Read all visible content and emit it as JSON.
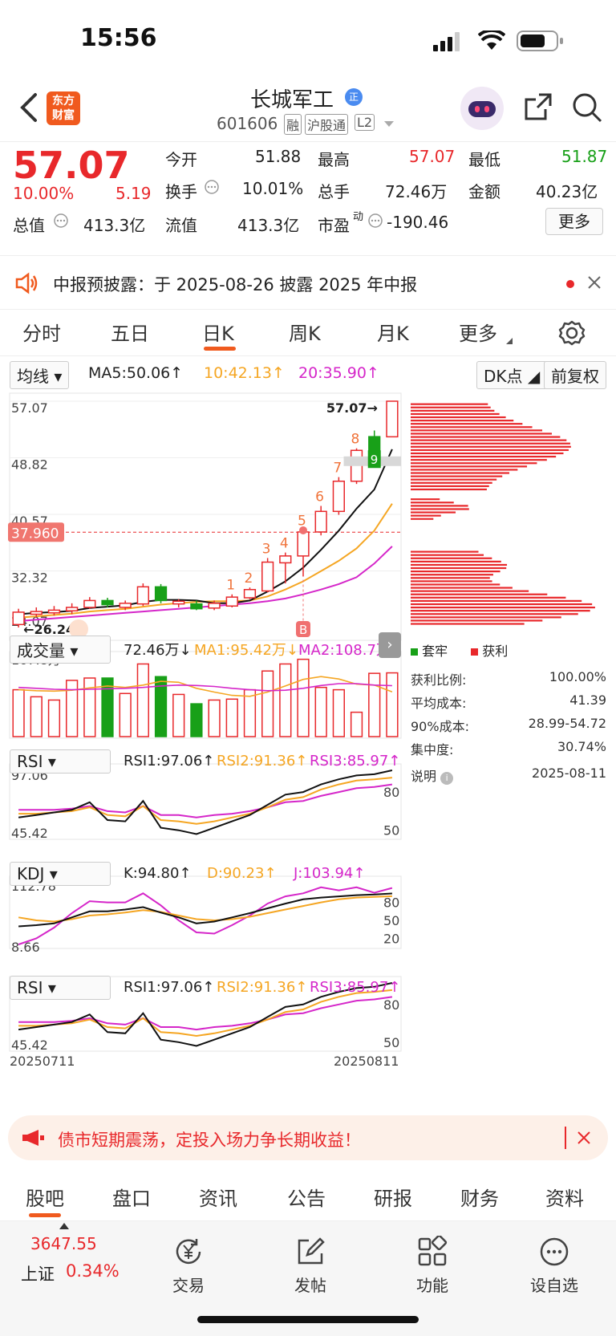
{
  "status": {
    "time": "15:56"
  },
  "header": {
    "logo_line1": "东方",
    "logo_line2": "财富",
    "title": "长城军工",
    "badge": "正",
    "code": "601606",
    "tags": [
      "融",
      "沪股通",
      "L2"
    ]
  },
  "quote": {
    "price": "57.07",
    "change_pct": "10.00%",
    "change": "5.19",
    "open_label": "今开",
    "open": "51.88",
    "high_label": "最高",
    "high": "57.07",
    "low_label": "最低",
    "low": "51.87",
    "turnover_label": "换手",
    "turnover": "10.01%",
    "volume_label": "总手",
    "volume": "72.46万",
    "amount_label": "金额",
    "amount": "40.23亿",
    "mktcap_label": "总值",
    "mktcap": "413.3亿",
    "float_label": "流值",
    "float": "413.3亿",
    "pe_label": "市盈",
    "pe_sup": "动",
    "pe": "-190.46",
    "more_button": "更多"
  },
  "notice": {
    "text": "中报预披露：于 2025-08-26 披露 2025 年中报"
  },
  "tabs": [
    "分时",
    "五日",
    "日K",
    "周K",
    "月K",
    "更多"
  ],
  "active_tab": "日K",
  "ma_bar": {
    "selector": "均线",
    "ma5": "MA5:50.06↑",
    "ma10": "10:42.13↑",
    "ma20": "20:35.90↑",
    "dk": "DK点",
    "adjust": "前复权"
  },
  "kline_axis": {
    "y_labels": [
      "57.07",
      "48.82",
      "40.57",
      "32.32",
      "24.07"
    ],
    "current_price_tag": "37.960",
    "high_marker": "57.07→",
    "low_marker": "←26.24",
    "signal_b": "B",
    "signal_9": "9",
    "counts": [
      "1",
      "2",
      "3",
      "4",
      "5",
      "6",
      "7",
      "8"
    ]
  },
  "volume_bar": {
    "selector": "成交量",
    "value": "72.46万↓",
    "ma1": "MA1:95.42万↓",
    "ma2": "MA2:108.7万",
    "max_label": "167.8万"
  },
  "rsi1": {
    "selector": "RSI",
    "r1": "RSI1:97.06↑",
    "r2": "RSI2:91.36↑",
    "r3": "RSI3:85.97↑",
    "top": "97.06",
    "bottom": "45.42",
    "lvl80": "80",
    "lvl50": "50"
  },
  "kdj": {
    "selector": "KDJ",
    "k": "K:94.80↑",
    "d": "D:90.23↑",
    "j": "J:103.94↑",
    "top": "112.78",
    "bottom": "8.66",
    "lvl80": "80",
    "lvl50": "50",
    "lvl20": "20"
  },
  "rsi2": {
    "selector": "RSI",
    "r1": "RSI1:97.06↑",
    "r2": "RSI2:91.36↑",
    "r3": "RSI3:85.97↑",
    "top": "97.06",
    "bottom": "45.42",
    "lvl80": "80",
    "lvl50": "50"
  },
  "dates": {
    "start": "20250711",
    "end": "20250811"
  },
  "chip": {
    "legend_trapped": "套牢",
    "legend_profit": "获利",
    "profit_ratio_label": "获利比例:",
    "profit_ratio": "100.00%",
    "avg_cost_label": "平均成本:",
    "avg_cost": "41.39",
    "cost90_label": "90%成本:",
    "cost90": "28.99-54.72",
    "concentration_label": "集中度:",
    "concentration": "30.74%",
    "note_label": "说明",
    "note_date": "2025-08-11"
  },
  "banner": {
    "text": "债市短期震荡，定投入场力争长期收益！"
  },
  "bottom_tabs": [
    "股吧",
    "盘口",
    "资讯",
    "公告",
    "研报",
    "财务",
    "资料"
  ],
  "bottom_bar": {
    "index_value": "3647.55",
    "index_name": "上证",
    "index_change": "0.34%",
    "items": [
      "交易",
      "发帖",
      "功能",
      "设自选"
    ]
  },
  "colors": {
    "up": "#e8282b",
    "down": "#18a018",
    "ma10": "#f5a623",
    "ma20": "#d526c9"
  },
  "chart_data": {
    "type": "candlestick",
    "dates_range": [
      "20250711",
      "20250811"
    ],
    "candles": [
      {
        "o": 24.5,
        "c": 26.3,
        "h": 26.8,
        "l": 24.07
      },
      {
        "o": 26.0,
        "c": 26.4,
        "h": 27.0,
        "l": 25.6
      },
      {
        "o": 26.2,
        "c": 26.6,
        "h": 27.2,
        "l": 25.8
      },
      {
        "o": 26.5,
        "c": 27.0,
        "h": 27.6,
        "l": 26.0
      },
      {
        "o": 27.0,
        "c": 28.0,
        "h": 28.5,
        "l": 26.8
      },
      {
        "o": 28.0,
        "c": 27.4,
        "h": 28.4,
        "l": 27.0
      },
      {
        "o": 27.0,
        "c": 27.6,
        "h": 28.0,
        "l": 26.6
      },
      {
        "o": 27.5,
        "c": 30.0,
        "h": 30.5,
        "l": 27.2
      },
      {
        "o": 30.0,
        "c": 28.0,
        "h": 30.4,
        "l": 27.6
      },
      {
        "o": 27.5,
        "c": 27.9,
        "h": 28.2,
        "l": 27.0
      },
      {
        "o": 27.5,
        "c": 26.8,
        "h": 28.0,
        "l": 26.6
      },
      {
        "o": 26.9,
        "c": 27.6,
        "h": 28.0,
        "l": 26.6
      },
      {
        "o": 27.2,
        "c": 28.5,
        "h": 28.9,
        "l": 27.0
      },
      {
        "o": 28.4,
        "c": 29.6,
        "h": 29.9,
        "l": 28.2
      },
      {
        "o": 29.4,
        "c": 33.6,
        "h": 34.2,
        "l": 29.2
      },
      {
        "o": 33.5,
        "c": 34.5,
        "h": 35.0,
        "l": 30.5
      },
      {
        "o": 34.5,
        "c": 38.0,
        "h": 38.3,
        "l": 31.5
      },
      {
        "o": 38.0,
        "c": 41.0,
        "h": 41.8,
        "l": 37.5
      },
      {
        "o": 41.0,
        "c": 45.4,
        "h": 46.0,
        "l": 40.5
      },
      {
        "o": 45.4,
        "c": 49.9,
        "h": 50.2,
        "l": 45.0
      },
      {
        "o": 51.9,
        "c": 48.5,
        "h": 52.8,
        "l": 47.8
      },
      {
        "o": 51.88,
        "c": 57.07,
        "h": 57.07,
        "l": 51.87
      }
    ],
    "y_range": [
      24.07,
      57.07
    ],
    "ma5": [
      26.0,
      26.2,
      26.3,
      26.5,
      26.9,
      27.1,
      27.3,
      27.8,
      28.1,
      28.1,
      28.0,
      27.6,
      27.6,
      28.0,
      29.3,
      30.8,
      32.8,
      35.4,
      38.2,
      41.4,
      44.2,
      50.06
    ],
    "ma10": [
      25.5,
      25.7,
      25.9,
      26.1,
      26.4,
      26.6,
      26.8,
      27.1,
      27.4,
      27.6,
      27.8,
      27.9,
      27.9,
      28.0,
      28.6,
      29.6,
      30.8,
      32.3,
      33.8,
      35.6,
      38.2,
      42.13
    ],
    "ma20": [
      25.0,
      25.2,
      25.4,
      25.6,
      25.8,
      26.0,
      26.2,
      26.4,
      26.6,
      26.8,
      27.0,
      27.2,
      27.4,
      27.6,
      27.9,
      28.3,
      28.9,
      29.6,
      30.4,
      31.4,
      33.4,
      35.9
    ],
    "volume": {
      "max": 167.8,
      "values": [
        100,
        85,
        78,
        120,
        125,
        125,
        92,
        155,
        128,
        90,
        70,
        78,
        80,
        100,
        140,
        155,
        165,
        105,
        100,
        52,
        135,
        136
      ],
      "up": [
        true,
        true,
        true,
        true,
        true,
        false,
        true,
        true,
        false,
        true,
        false,
        true,
        true,
        true,
        true,
        true,
        true,
        true,
        true,
        true,
        true,
        true
      ],
      "ma1": [
        100,
        98,
        97,
        99,
        104,
        108,
        105,
        110,
        118,
        116,
        103,
        95,
        88,
        86,
        95,
        108,
        122,
        128,
        123,
        112,
        110,
        95.42
      ],
      "ma2": [
        105,
        103,
        101,
        100,
        101,
        102,
        103,
        105,
        108,
        110,
        109,
        107,
        103,
        100,
        98,
        99,
        103,
        109,
        113,
        113,
        110,
        108.7
      ]
    },
    "rsi": {
      "range": [
        45.42,
        97.06
      ],
      "rsi1": [
        60,
        62,
        64,
        66,
        72,
        58,
        57,
        73,
        52,
        50,
        47,
        52,
        57,
        62,
        70,
        78,
        80,
        86,
        90,
        93,
        94,
        97.06
      ],
      "rsi2": [
        63,
        63,
        64,
        65,
        68,
        62,
        61,
        69,
        58,
        57,
        55,
        57,
        60,
        63,
        68,
        74,
        76,
        82,
        86,
        89,
        90,
        91.36
      ],
      "rsi3": [
        66,
        66,
        66,
        67,
        69,
        65,
        64,
        69,
        62,
        62,
        60,
        62,
        63,
        65,
        68,
        72,
        73,
        77,
        80,
        83,
        84,
        85.97
      ]
    },
    "kdj": {
      "range": [
        8.66,
        112.78
      ],
      "k": [
        40,
        42,
        45,
        55,
        65,
        65,
        68,
        72,
        63,
        55,
        45,
        48,
        55,
        62,
        70,
        78,
        85,
        88,
        90,
        92,
        93,
        94.8
      ],
      "d": [
        55,
        50,
        48,
        52,
        58,
        60,
        63,
        67,
        64,
        58,
        52,
        50,
        52,
        56,
        62,
        68,
        74,
        80,
        85,
        88,
        89,
        90.23
      ],
      "j": [
        10,
        20,
        38,
        62,
        82,
        80,
        80,
        95,
        75,
        50,
        30,
        28,
        42,
        58,
        78,
        90,
        95,
        105,
        100,
        105,
        96,
        103.94
      ]
    },
    "chip_distribution": {
      "profit_ratio": "100.00%",
      "avg_cost": 41.39,
      "cost90": [
        28.99,
        54.72
      ],
      "concentration": "30.74%"
    }
  }
}
